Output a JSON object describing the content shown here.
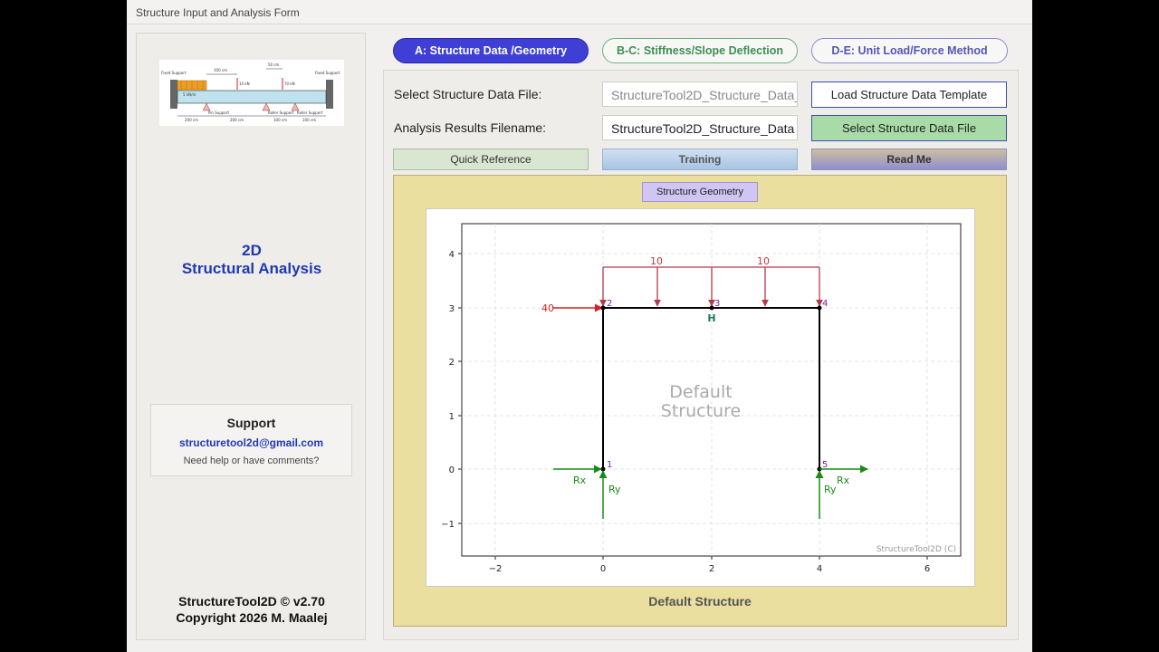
{
  "window": {
    "title": "Structure Input and Analysis Form"
  },
  "sidebar": {
    "thumbnail": {
      "left_support": "Fixed Support",
      "right_support": "Fixed Support",
      "dim_top_1": "100 cm",
      "dim_top_2": "50 cm",
      "load_1": "10 kN",
      "load_2": "70 kN",
      "dist_load": "5 kN/m",
      "pin_support": "Pin Support",
      "roller_support_1": "Roller Support",
      "roller_support_2": "Roller Support",
      "dim_1": "200 cm",
      "dim_2": "200 cm",
      "dim_3": "100 cm",
      "dim_4": "100 cm"
    },
    "title_line1": "2D",
    "title_line2": "Structural Analysis",
    "support": {
      "title": "Support",
      "email": "structuretool2d@gmail.com",
      "help": "Need help or have comments?"
    },
    "footer_line1": "StructureTool2D © v2.70",
    "footer_line2": "Copyright 2026 M. Maalej"
  },
  "tabs": [
    {
      "label": "A: Structure Data /Geometry",
      "active": true
    },
    {
      "label": "B-C: Stiffness/Slope Deflection",
      "active": false
    },
    {
      "label": "D-E: Unit Load/Force Method",
      "active": false
    }
  ],
  "form": {
    "data_file_label": "Select Structure Data File:",
    "data_file_value": "StructureTool2D_Structure_Data_",
    "results_label": "Analysis Results Filename:",
    "results_value": "StructureTool2D_Structure_Data",
    "load_template_button": "Load Structure Data Template",
    "select_file_button": "Select Structure Data File",
    "quick_reference_button": "Quick Reference",
    "training_button": "Training",
    "read_me_button": "Read Me",
    "geometry_button": "Structure Geometry",
    "caption": "Default Structure"
  },
  "plot": {
    "watermark_line1": "Default",
    "watermark_line2": "Structure",
    "credit": "StructureTool2D (C)",
    "x_ticks": [
      "−2",
      "0",
      "2",
      "4",
      "6"
    ],
    "y_ticks": [
      "4",
      "3",
      "2",
      "1",
      "0",
      "−1"
    ],
    "nodes": [
      "1",
      "2",
      "3",
      "4",
      "5"
    ],
    "hinge_label": "H",
    "point_load_label": "40",
    "udl_label_1": "10",
    "udl_label_2": "10",
    "reaction_rx": "Rx",
    "reaction_ry": "Ry",
    "colors": {
      "load": "#b33a4a",
      "point_load": "#d62020",
      "reaction": "#1a8a1a",
      "node_label": "#7a1fa2",
      "hinge": "#1a7a5a"
    }
  }
}
